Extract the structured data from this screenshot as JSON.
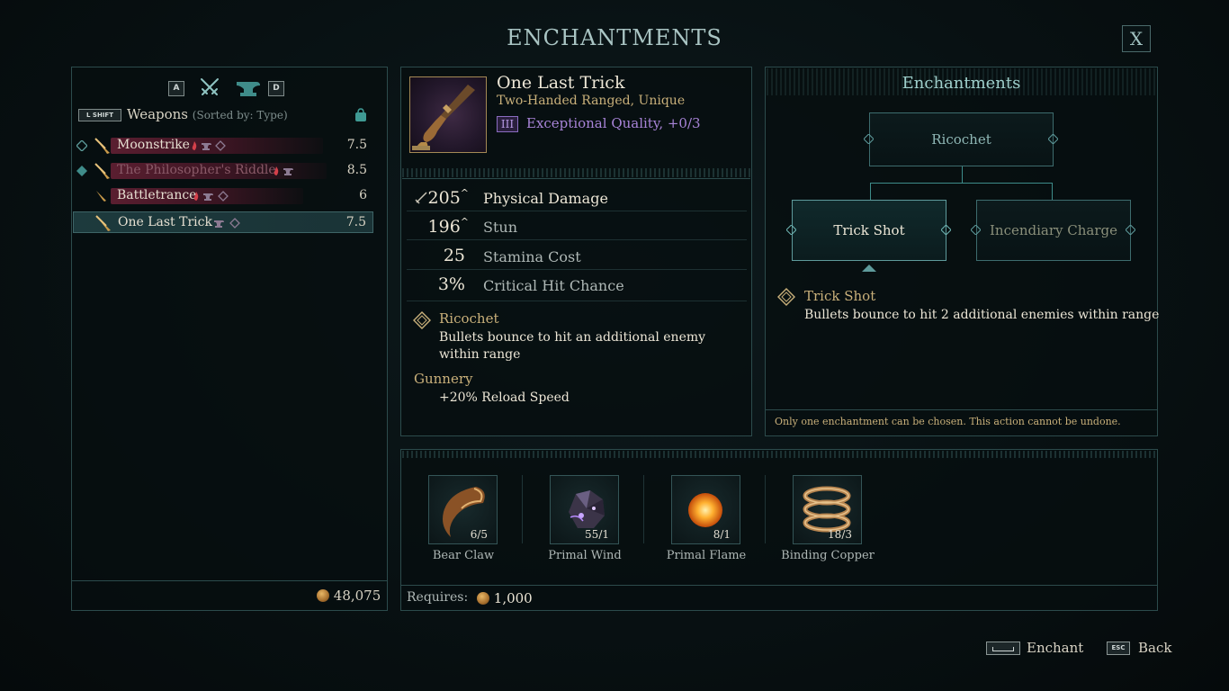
{
  "screen": {
    "title": "ENCHANTMENTS",
    "close_label": "X"
  },
  "inventory": {
    "tab_key_left": "A",
    "tab_key_right": "D",
    "filter_key": "L SHIFT",
    "category": "Weapons",
    "sort_label": "(Sorted by: Type)",
    "items": [
      {
        "name": "Moonstrike",
        "value": "7.5"
      },
      {
        "name": "The Philosopher's Riddle",
        "value": "8.5"
      },
      {
        "name": "Battletrance",
        "value": "6"
      },
      {
        "name": "One Last Trick",
        "value": "7.5"
      }
    ],
    "gold_total": "48,075"
  },
  "detail": {
    "name": "One Last Trick",
    "type": "Two-Handed Ranged, Unique",
    "quality_tier": "III",
    "quality": "Exceptional Quality, +0/3",
    "stats": [
      {
        "value": "205",
        "label": "Physical Damage"
      },
      {
        "value": "196",
        "label": "Stun"
      },
      {
        "value": "25",
        "label": "Stamina Cost"
      },
      {
        "value": "3%",
        "label": "Critical Hit Chance"
      }
    ],
    "enchant_name": "Ricochet",
    "enchant_desc": "Bullets bounce to hit an additional enemy within range",
    "passive_name": "Gunnery",
    "passive_desc": "+20% Reload Speed"
  },
  "enchant_tree": {
    "title": "Enchantments",
    "root": "Ricochet",
    "option_left": "Trick Shot",
    "option_right": "Incendiary Charge",
    "selected_name": "Trick Shot",
    "selected_desc": "Bullets bounce to hit 2 additional enemies within range",
    "warning": "Only one enchantment can be chosen. This action cannot be undone."
  },
  "materials": {
    "items": [
      {
        "name": "Bear Claw",
        "count": "6/5"
      },
      {
        "name": "Primal Wind",
        "count": "55/1"
      },
      {
        "name": "Primal Flame",
        "count": "8/1"
      },
      {
        "name": "Binding Copper",
        "count": "18/3"
      }
    ],
    "requires_label": "Requires:",
    "requires_cost": "1,000"
  },
  "hints": {
    "enchant_label": "Enchant",
    "back_key": "ESC",
    "back_label": "Back"
  },
  "colors": {
    "accent_teal": "#2c4b4c",
    "gold_text": "#c9b07a",
    "quality_purple": "#a884d8",
    "item_bar_red": "#5a1e30"
  }
}
